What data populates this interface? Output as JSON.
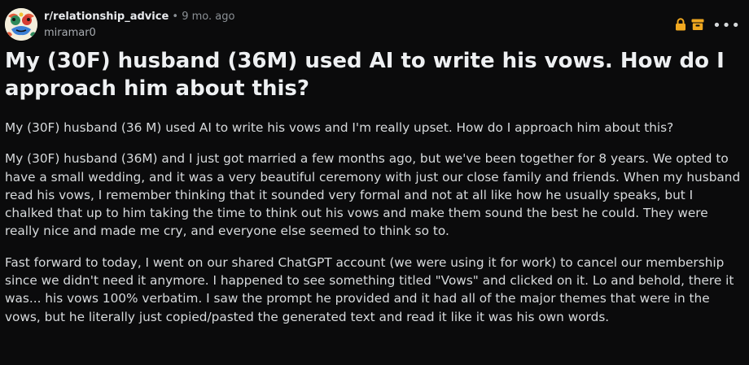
{
  "post": {
    "subreddit": "r/relationship_advice",
    "separator": "•",
    "age": "9 mo. ago",
    "username": "miramar0",
    "title": "My (30F) husband (36M) used AI to write his vows. How do I approach him about this?",
    "paragraphs": [
      "My (30F) husband (36 M) used AI to write his vows and I'm really upset. How do I approach him about this?",
      "My (30F) husband (36M) and I just got married a few months ago, but we've been together for 8 years. We opted to have a small wedding, and it was a very beautiful ceremony with just our close family and friends. When my husband read his vows, I remember thinking that it sounded very formal and not at all like how he usually speaks, but I chalked that up to him taking the time to think out his vows and make them sound the best he could. They were really nice and made me cry, and everyone else seemed to think so to.",
      "Fast forward to today, I went on our shared ChatGPT account (we were using it for work) to cancel our membership since we didn't need it anymore. I happened to see something titled \"Vows\" and clicked on it. Lo and behold, there it was... his vows 100% verbatim. I saw the prompt he provided and it had all of the major themes that were in the vows, but he literally just copied/pasted the generated text and read it like it was his own words."
    ]
  },
  "icons": {
    "avatar": "subreddit-avatar",
    "locked": "lock-icon",
    "archived": "archive-icon",
    "more": "more-options-icon",
    "more_glyph": "•••"
  },
  "colors": {
    "background": "#0b0b0c",
    "text": "#d7dadc",
    "muted": "#8b9095",
    "status_icon": "#f0a820"
  }
}
